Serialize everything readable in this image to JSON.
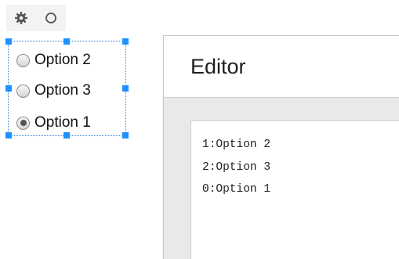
{
  "toolbar": {
    "icons": [
      "gear-icon",
      "circle-icon"
    ]
  },
  "radio_group": {
    "options": [
      {
        "label": "Option 2",
        "selected": false
      },
      {
        "label": "Option 3",
        "selected": false
      },
      {
        "label": "Option 1",
        "selected": true
      }
    ],
    "selection_color": "#1e90ff"
  },
  "editor": {
    "title": "Editor",
    "lines": [
      "1:Option 2",
      "2:Option 3",
      "0:Option 1"
    ]
  }
}
